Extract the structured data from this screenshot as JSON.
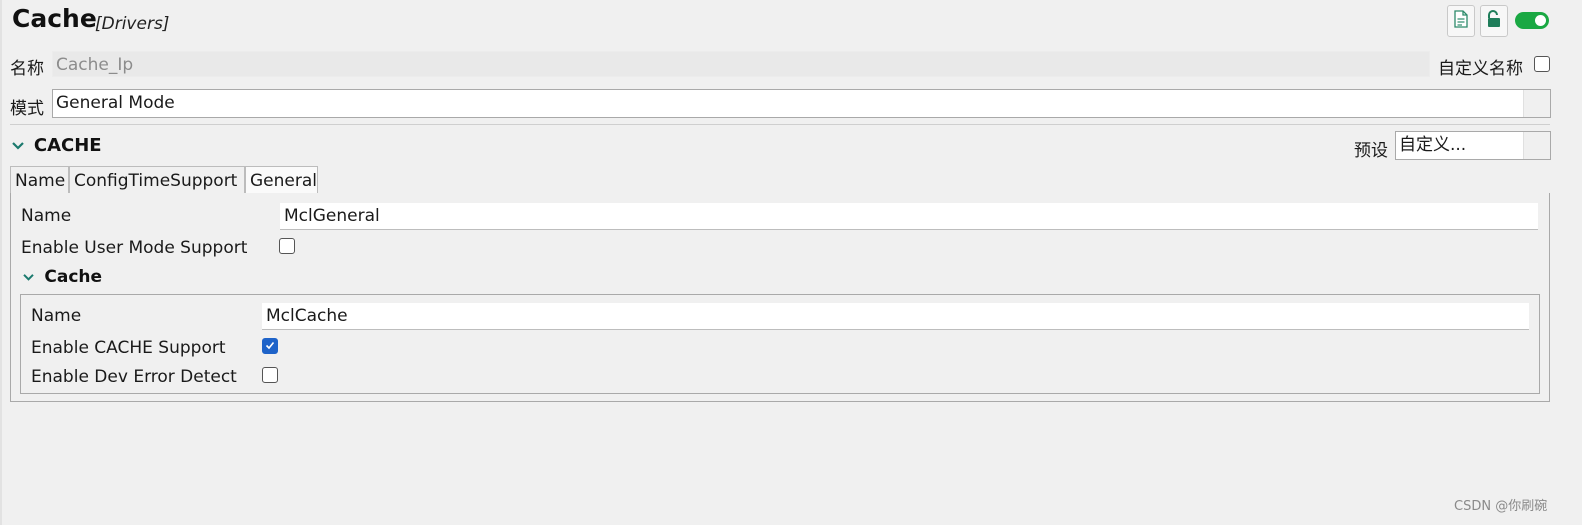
{
  "header": {
    "title": "Cache",
    "subtitle": "[Drivers]",
    "toolbar": {
      "doc_icon": "document-icon",
      "lock_icon": "unlock-icon",
      "toggle_on": true
    }
  },
  "name_row": {
    "label": "名称",
    "value": "Cache_Ip",
    "custom_name_label": "自定义名称",
    "custom_name_checked": false
  },
  "mode_row": {
    "label": "模式",
    "value": "General Mode"
  },
  "section": {
    "title": "CACHE",
    "preset_label": "预设",
    "preset_value": "自定义..."
  },
  "tabs": [
    {
      "label": "Name"
    },
    {
      "label": "ConfigTimeSupport"
    },
    {
      "label": "General",
      "active": true
    }
  ],
  "general": {
    "name_label": "Name",
    "name_value": "MclGeneral",
    "user_mode_label": "Enable User Mode Support",
    "user_mode_checked": false,
    "cache_group": {
      "title": "Cache",
      "name_label": "Name",
      "name_value": "MclCache",
      "cache_support_label": "Enable CACHE Support",
      "cache_support_checked": true,
      "dev_error_label": "Enable Dev Error Detect",
      "dev_error_checked": false
    }
  },
  "watermark": "CSDN @你刷碗",
  "colors": {
    "accent_green": "#1aa843",
    "checkbox_blue": "#1e63c9",
    "chevron_teal": "#1b7a6e"
  }
}
